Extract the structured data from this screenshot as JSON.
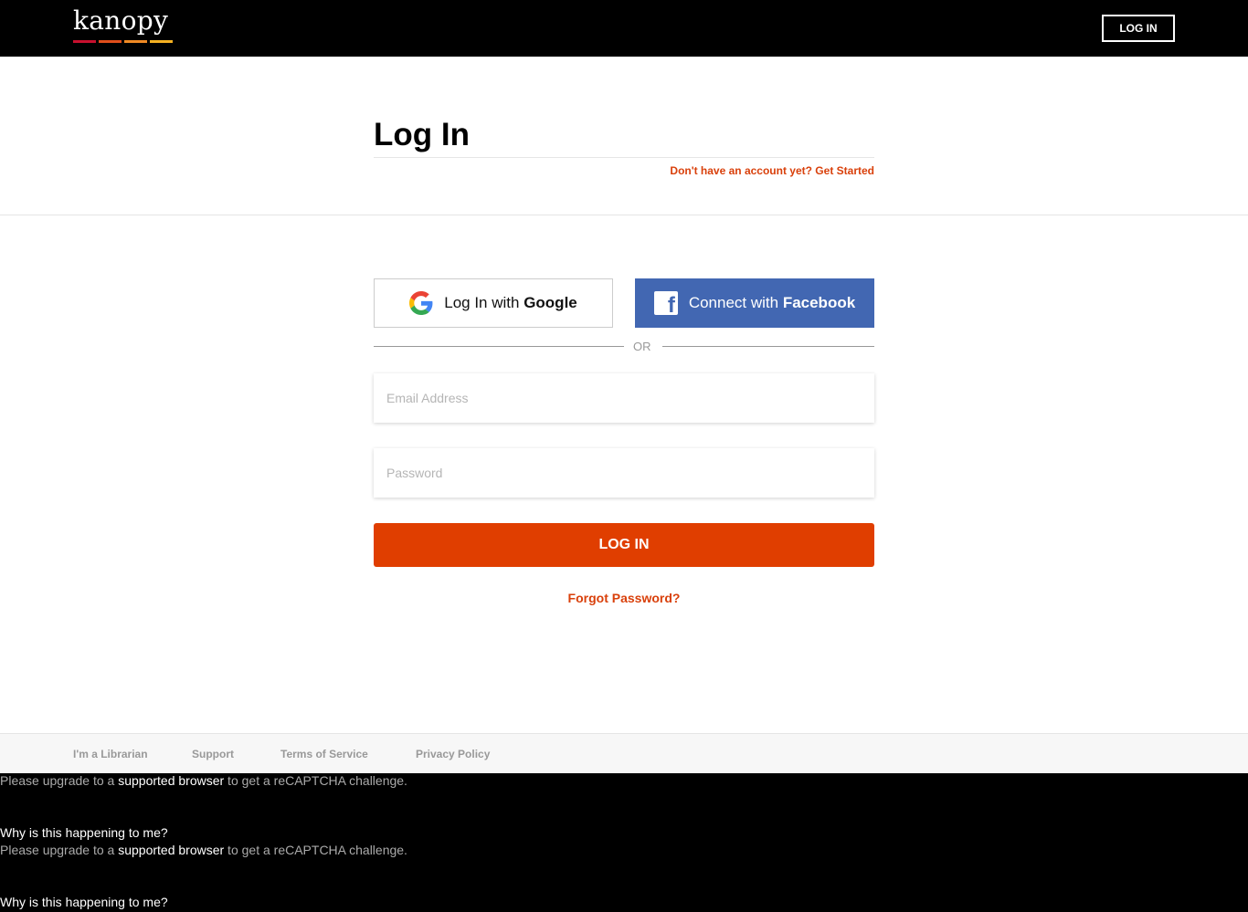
{
  "header": {
    "logo_text": "kanopy",
    "logo_colors": [
      "#c8102e",
      "#e04e1b",
      "#f08a24",
      "#f5b122"
    ],
    "login_label": "LOG IN"
  },
  "hero": {
    "title": "Log In",
    "signup_prompt": "Don't have an account yet? Get Started"
  },
  "social": {
    "google_prefix": "Log In with ",
    "google_brand": "Google",
    "facebook_prefix": "Connect with ",
    "facebook_brand": "Facebook",
    "facebook_color": "#4267b2"
  },
  "divider": {
    "text": "OR"
  },
  "form": {
    "email_placeholder": "Email Address",
    "password_placeholder": "Password",
    "submit_label": "LOG IN",
    "submit_color": "#e03e00",
    "forgot_label": "Forgot Password?"
  },
  "footer": {
    "links": [
      "I'm a Librarian",
      "Support",
      "Terms of Service",
      "Privacy Policy"
    ]
  },
  "recaptcha": {
    "pre": "Please upgrade to a ",
    "link": "supported browser",
    "post": " to get a reCAPTCHA challenge.",
    "why": "Why is this happening to me?"
  }
}
